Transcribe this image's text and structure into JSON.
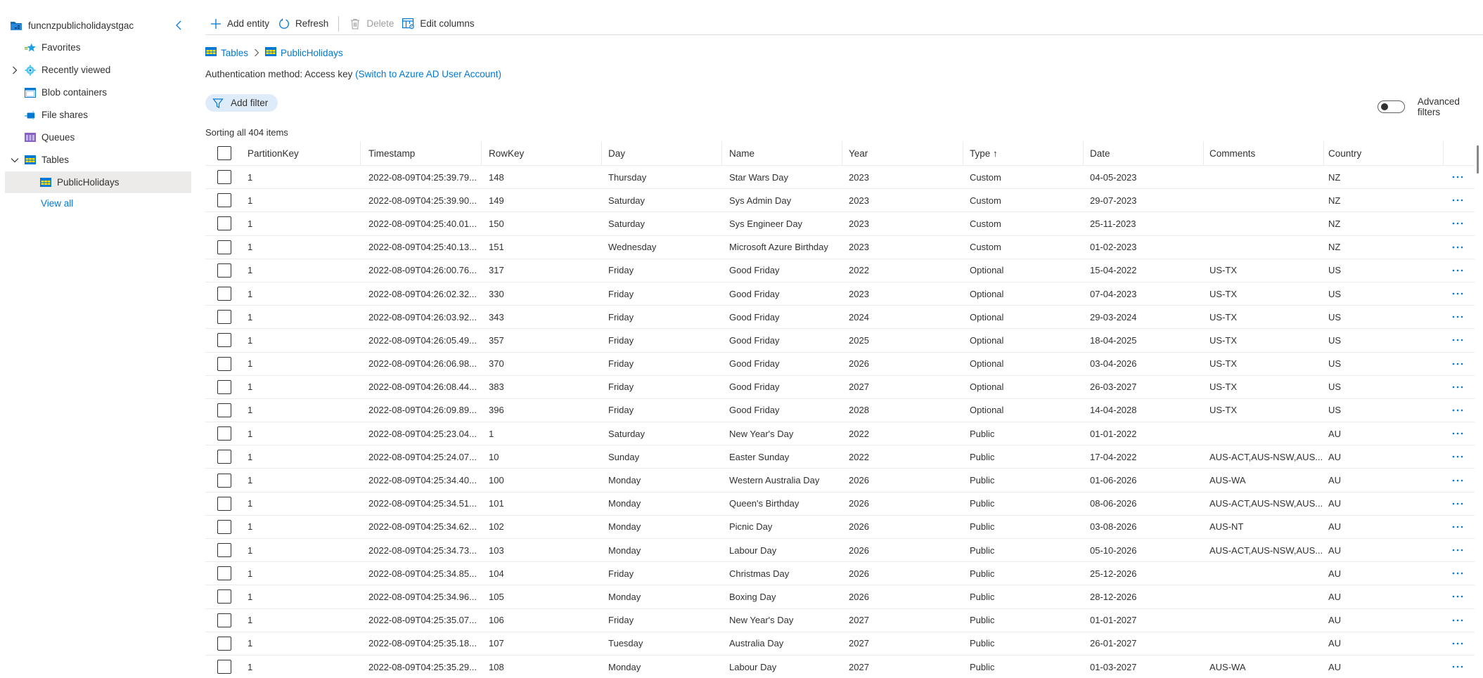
{
  "sidebar": {
    "account": "funcnzpublicholidaystgac",
    "items": [
      {
        "label": "Favorites",
        "icon": "star-icon",
        "expandable": false
      },
      {
        "label": "Recently viewed",
        "icon": "gear-icon",
        "expandable": true,
        "expanded": false
      },
      {
        "label": "Blob containers",
        "icon": "blob-container-icon",
        "expandable": false
      },
      {
        "label": "File shares",
        "icon": "file-share-icon",
        "expandable": false
      },
      {
        "label": "Queues",
        "icon": "queue-icon",
        "expandable": false
      },
      {
        "label": "Tables",
        "icon": "table-icon",
        "expandable": true,
        "expanded": true
      },
      {
        "label": "PublicHolidays",
        "icon": "table-icon",
        "selected": true
      }
    ],
    "view_all": "View all"
  },
  "toolbar": {
    "add_entity": "Add entity",
    "refresh": "Refresh",
    "delete": "Delete",
    "edit_columns": "Edit columns"
  },
  "breadcrumb": {
    "root": "Tables",
    "current": "PublicHolidays"
  },
  "auth": {
    "label": "Authentication method:",
    "value": "Access key",
    "switch_link": "(Switch to Azure AD User Account)"
  },
  "filter": {
    "add_filter": "Add filter",
    "advanced_filters": "Advanced filters",
    "advanced_enabled": false
  },
  "sort_info": "Sorting all 404 items",
  "table": {
    "columns": [
      "PartitionKey",
      "Timestamp",
      "RowKey",
      "Day",
      "Name",
      "Year",
      "Type ↑",
      "Date",
      "Comments",
      "Country"
    ],
    "sorted_column": "Type",
    "sort_direction": "ascending",
    "rows": [
      [
        "1",
        "2022-08-09T04:25:39.79...",
        "148",
        "Thursday",
        "Star Wars Day",
        "2023",
        "Custom",
        "04-05-2023",
        "",
        "NZ"
      ],
      [
        "1",
        "2022-08-09T04:25:39.90...",
        "149",
        "Saturday",
        "Sys Admin Day",
        "2023",
        "Custom",
        "29-07-2023",
        "",
        "NZ"
      ],
      [
        "1",
        "2022-08-09T04:25:40.01...",
        "150",
        "Saturday",
        "Sys Engineer Day",
        "2023",
        "Custom",
        "25-11-2023",
        "",
        "NZ"
      ],
      [
        "1",
        "2022-08-09T04:25:40.13...",
        "151",
        "Wednesday",
        "Microsoft Azure Birthday",
        "2023",
        "Custom",
        "01-02-2023",
        "",
        "NZ"
      ],
      [
        "1",
        "2022-08-09T04:26:00.76...",
        "317",
        "Friday",
        "Good Friday",
        "2022",
        "Optional",
        "15-04-2022",
        "US-TX",
        "US"
      ],
      [
        "1",
        "2022-08-09T04:26:02.32...",
        "330",
        "Friday",
        "Good Friday",
        "2023",
        "Optional",
        "07-04-2023",
        "US-TX",
        "US"
      ],
      [
        "1",
        "2022-08-09T04:26:03.92...",
        "343",
        "Friday",
        "Good Friday",
        "2024",
        "Optional",
        "29-03-2024",
        "US-TX",
        "US"
      ],
      [
        "1",
        "2022-08-09T04:26:05.49...",
        "357",
        "Friday",
        "Good Friday",
        "2025",
        "Optional",
        "18-04-2025",
        "US-TX",
        "US"
      ],
      [
        "1",
        "2022-08-09T04:26:06.98...",
        "370",
        "Friday",
        "Good Friday",
        "2026",
        "Optional",
        "03-04-2026",
        "US-TX",
        "US"
      ],
      [
        "1",
        "2022-08-09T04:26:08.44...",
        "383",
        "Friday",
        "Good Friday",
        "2027",
        "Optional",
        "26-03-2027",
        "US-TX",
        "US"
      ],
      [
        "1",
        "2022-08-09T04:26:09.89...",
        "396",
        "Friday",
        "Good Friday",
        "2028",
        "Optional",
        "14-04-2028",
        "US-TX",
        "US"
      ],
      [
        "1",
        "2022-08-09T04:25:23.04...",
        "1",
        "Saturday",
        "New Year's Day",
        "2022",
        "Public",
        "01-01-2022",
        "",
        "AU"
      ],
      [
        "1",
        "2022-08-09T04:25:24.07...",
        "10",
        "Sunday",
        "Easter Sunday",
        "2022",
        "Public",
        "17-04-2022",
        "AUS-ACT,AUS-NSW,AUS...",
        "AU"
      ],
      [
        "1",
        "2022-08-09T04:25:34.40...",
        "100",
        "Monday",
        "Western Australia Day",
        "2026",
        "Public",
        "01-06-2026",
        "AUS-WA",
        "AU"
      ],
      [
        "1",
        "2022-08-09T04:25:34.51...",
        "101",
        "Monday",
        "Queen's Birthday",
        "2026",
        "Public",
        "08-06-2026",
        "AUS-ACT,AUS-NSW,AUS...",
        "AU"
      ],
      [
        "1",
        "2022-08-09T04:25:34.62...",
        "102",
        "Monday",
        "Picnic Day",
        "2026",
        "Public",
        "03-08-2026",
        "AUS-NT",
        "AU"
      ],
      [
        "1",
        "2022-08-09T04:25:34.73...",
        "103",
        "Monday",
        "Labour Day",
        "2026",
        "Public",
        "05-10-2026",
        "AUS-ACT,AUS-NSW,AUS...",
        "AU"
      ],
      [
        "1",
        "2022-08-09T04:25:34.85...",
        "104",
        "Friday",
        "Christmas Day",
        "2026",
        "Public",
        "25-12-2026",
        "",
        "AU"
      ],
      [
        "1",
        "2022-08-09T04:25:34.96...",
        "105",
        "Monday",
        "Boxing Day",
        "2026",
        "Public",
        "28-12-2026",
        "",
        "AU"
      ],
      [
        "1",
        "2022-08-09T04:25:35.07...",
        "106",
        "Friday",
        "New Year's Day",
        "2027",
        "Public",
        "01-01-2027",
        "",
        "AU"
      ],
      [
        "1",
        "2022-08-09T04:25:35.18...",
        "107",
        "Tuesday",
        "Australia Day",
        "2027",
        "Public",
        "26-01-2027",
        "",
        "AU"
      ],
      [
        "1",
        "2022-08-09T04:25:35.29...",
        "108",
        "Monday",
        "Labour Day",
        "2027",
        "Public",
        "01-03-2027",
        "AUS-WA",
        "AU"
      ]
    ],
    "row_action_icon": "more-actions-icon"
  },
  "colors": {
    "accent": "#0078d4",
    "selected_bg": "#edebe9",
    "filter_pill_bg": "#deecf9",
    "disabled_text": "#a19f9d"
  }
}
